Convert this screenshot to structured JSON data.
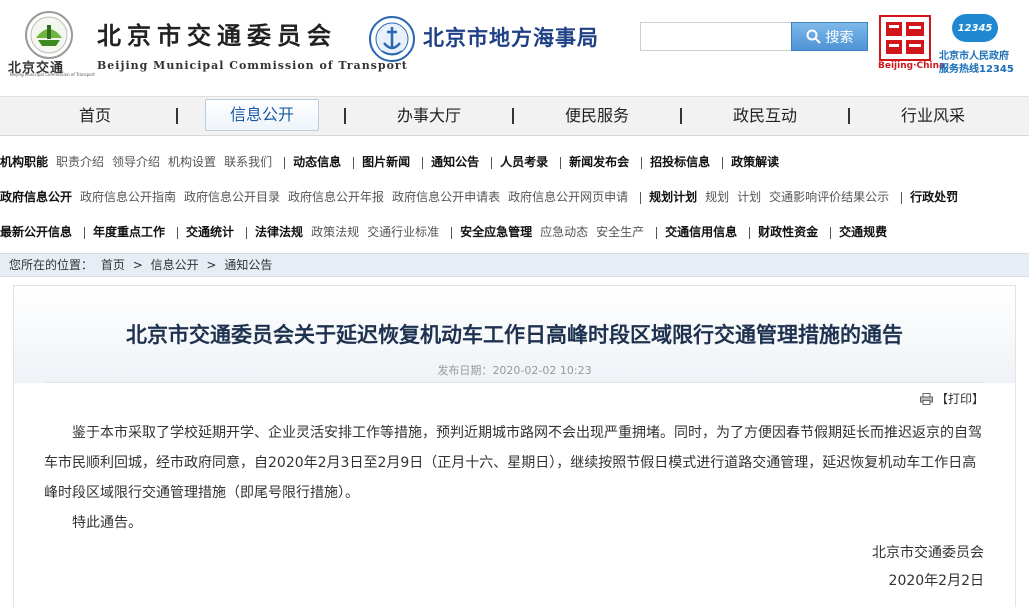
{
  "header": {
    "logo_sub_cn": "北京交通",
    "logo_sub_en": "Beijing Municipal Commission of Transport",
    "org_name_cn": "北京市交通委员会",
    "org_name_en": "Beijing Municipal Commission of Transport",
    "msa_name": "北京市地方海事局",
    "search_placeholder": "",
    "search_label": "搜索",
    "capital_logo_text": "Beijing·China",
    "hotline_badge": "12345",
    "hotline_line1": "北京市人民政府",
    "hotline_line2": "服务热线12345"
  },
  "nav": {
    "items": [
      "首页",
      "信息公开",
      "办事大厅",
      "便民服务",
      "政民互动",
      "行业风采"
    ],
    "active_index": 1
  },
  "subnav": {
    "rows": [
      [
        {
          "type": "cat",
          "text": "机构职能"
        },
        {
          "type": "lnk",
          "text": "职责介绍"
        },
        {
          "type": "lnk",
          "text": "领导介绍"
        },
        {
          "type": "lnk",
          "text": "机构设置"
        },
        {
          "type": "lnk",
          "text": "联系我们"
        },
        {
          "type": "bar"
        },
        {
          "type": "cat",
          "text": "动态信息"
        },
        {
          "type": "bar"
        },
        {
          "type": "cat",
          "text": "图片新闻"
        },
        {
          "type": "bar"
        },
        {
          "type": "cat",
          "text": "通知公告"
        },
        {
          "type": "bar"
        },
        {
          "type": "cat",
          "text": "人员考录"
        },
        {
          "type": "bar"
        },
        {
          "type": "cat",
          "text": "新闻发布会"
        },
        {
          "type": "bar"
        },
        {
          "type": "cat",
          "text": "招投标信息"
        },
        {
          "type": "bar"
        },
        {
          "type": "cat",
          "text": "政策解读"
        }
      ],
      [
        {
          "type": "cat",
          "text": "政府信息公开"
        },
        {
          "type": "lnk",
          "text": "政府信息公开指南"
        },
        {
          "type": "lnk",
          "text": "政府信息公开目录"
        },
        {
          "type": "lnk",
          "text": "政府信息公开年报"
        },
        {
          "type": "lnk",
          "text": "政府信息公开申请表"
        },
        {
          "type": "lnk",
          "text": "政府信息公开网页申请"
        },
        {
          "type": "bar"
        },
        {
          "type": "cat",
          "text": "规划计划"
        },
        {
          "type": "lnk",
          "text": "规划"
        },
        {
          "type": "lnk",
          "text": "计划"
        },
        {
          "type": "lnk",
          "text": "交通影响评价结果公示"
        },
        {
          "type": "bar"
        },
        {
          "type": "cat",
          "text": "行政处罚"
        }
      ],
      [
        {
          "type": "cat",
          "text": "最新公开信息"
        },
        {
          "type": "bar"
        },
        {
          "type": "cat",
          "text": "年度重点工作"
        },
        {
          "type": "bar"
        },
        {
          "type": "cat",
          "text": "交通统计"
        },
        {
          "type": "bar"
        },
        {
          "type": "cat",
          "text": "法律法规"
        },
        {
          "type": "lnk",
          "text": "政策法规"
        },
        {
          "type": "lnk",
          "text": "交通行业标准"
        },
        {
          "type": "bar"
        },
        {
          "type": "cat",
          "text": "安全应急管理"
        },
        {
          "type": "lnk",
          "text": "应急动态"
        },
        {
          "type": "lnk",
          "text": "安全生产"
        },
        {
          "type": "bar"
        },
        {
          "type": "cat",
          "text": "交通信用信息"
        },
        {
          "type": "bar"
        },
        {
          "type": "cat",
          "text": "财政性资金"
        },
        {
          "type": "bar"
        },
        {
          "type": "cat",
          "text": "交通规费"
        }
      ]
    ]
  },
  "breadcrumb": {
    "label": "您所在的位置：",
    "items": [
      "首页",
      "信息公开",
      "通知公告"
    ],
    "separator": ">"
  },
  "article": {
    "title": "北京市交通委员会关于延迟恢复机动车工作日高峰时段区域限行交通管理措施的通告",
    "pub_date_label": "发布日期：",
    "pub_date": "2020-02-02 10:23",
    "print_label": "【打印】",
    "body": "鉴于本市采取了学校延期开学、企业灵活安排工作等措施，预判近期城市路网不会出现严重拥堵。同时，为了方便因春节假期延长而推迟返京的自驾车市民顺利回城，经市政府同意，自2020年2月3日至2月9日（正月十六、星期日），继续按照节假日模式进行道路交通管理，延迟恢复机动车工作日高峰时段区域限行交通管理措施（即尾号限行措施）。",
    "closing": "特此通告。",
    "signer": "北京市交通委员会",
    "sign_date": "2020年2月2日"
  },
  "colors": {
    "accent_blue": "#1e5aa6",
    "search_button": "#4d93d6",
    "capital_red": "#d1161b",
    "hotline_blue": "#1e88d1"
  },
  "icons": {
    "emblem": "beijing-transport-emblem-icon",
    "msa": "msa-emblem-icon",
    "search": "search-icon",
    "capital": "capital-logo-icon",
    "print": "printer-icon"
  }
}
